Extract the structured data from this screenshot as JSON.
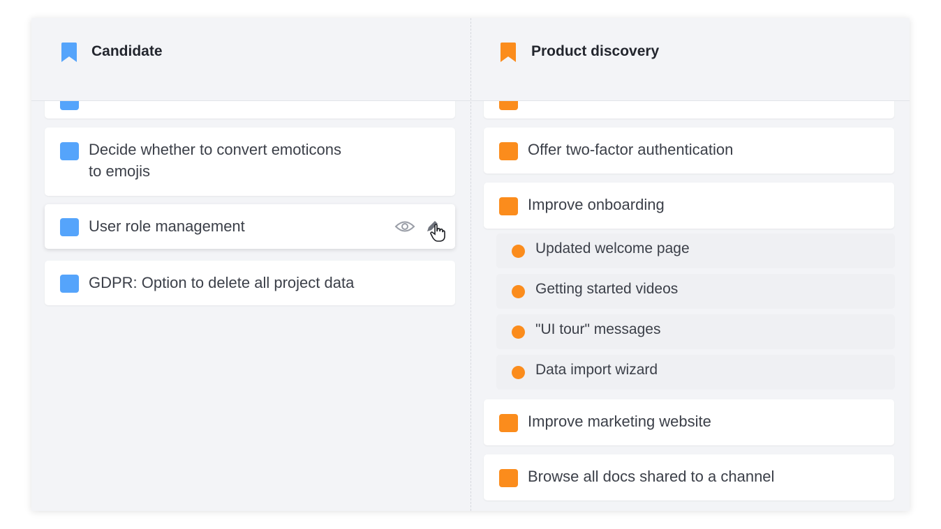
{
  "columns": [
    {
      "title": "Candidate",
      "color": "#55a4fb",
      "icon": "bookmark-icon",
      "cards": [
        {
          "label": "Decide whether to convert emoticons"
        },
        {
          "label": "to emojis"
        },
        {
          "label": "User role management"
        },
        {
          "label": "GDPR: Option to delete all project data"
        }
      ]
    },
    {
      "title": "Product discovery",
      "color": "#fb8c1c",
      "icon": "bookmark-icon",
      "cards": [
        {
          "label": "Offer two-factor authentication"
        },
        {
          "label": "Improve onboarding"
        },
        {
          "label": "Improve marketing website"
        },
        {
          "label": "Browse all docs shared to a channel"
        }
      ],
      "subitems": [
        {
          "label": "Updated welcome page"
        },
        {
          "label": "Getting started videos"
        },
        {
          "label": "\"UI tour\" messages"
        },
        {
          "label": "Data import wizard"
        }
      ]
    }
  ],
  "card_actions": {
    "view_icon": "eye-icon",
    "edit_icon": "pencil-icon",
    "cursor_icon": "hand-pointer-icon"
  }
}
